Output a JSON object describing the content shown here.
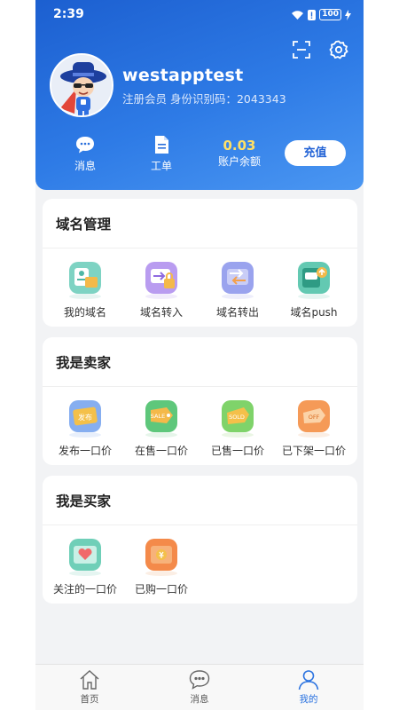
{
  "status_bar": {
    "time": "2:39",
    "battery": "100"
  },
  "profile": {
    "username": "westapptest",
    "member_info": "注册会员 身份识别码：2043343"
  },
  "stats": {
    "messages_label": "消息",
    "tickets_label": "工单",
    "balance_value": "0.03",
    "balance_label": "账户余额",
    "recharge_label": "充值"
  },
  "sections": {
    "domain": {
      "title": "域名管理",
      "items": [
        {
          "label": "我的域名",
          "icon": "my-domain-icon"
        },
        {
          "label": "域名转入",
          "icon": "domain-transfer-in-icon"
        },
        {
          "label": "域名转出",
          "icon": "domain-transfer-out-icon"
        },
        {
          "label": "域名push",
          "icon": "domain-push-icon"
        }
      ]
    },
    "seller": {
      "title": "我是卖家",
      "items": [
        {
          "label": "发布一口价",
          "icon": "publish-price-icon",
          "tag": "发布"
        },
        {
          "label": "在售一口价",
          "icon": "on-sale-icon",
          "tag": "SALE"
        },
        {
          "label": "已售一口价",
          "icon": "sold-icon",
          "tag": "SOLD"
        },
        {
          "label": "已下架一口价",
          "icon": "off-shelf-icon",
          "tag": "OFF"
        }
      ]
    },
    "buyer": {
      "title": "我是买家",
      "items": [
        {
          "label": "关注的一口价",
          "icon": "followed-price-icon"
        },
        {
          "label": "已购一口价",
          "icon": "purchased-price-icon"
        }
      ]
    }
  },
  "tabbar": {
    "home": "首页",
    "messages": "消息",
    "mine": "我的"
  },
  "colors": {
    "header_start": "#1c5fd0",
    "header_end": "#4b97f2",
    "accent": "#2a72e0",
    "balance": "#ffe066"
  }
}
